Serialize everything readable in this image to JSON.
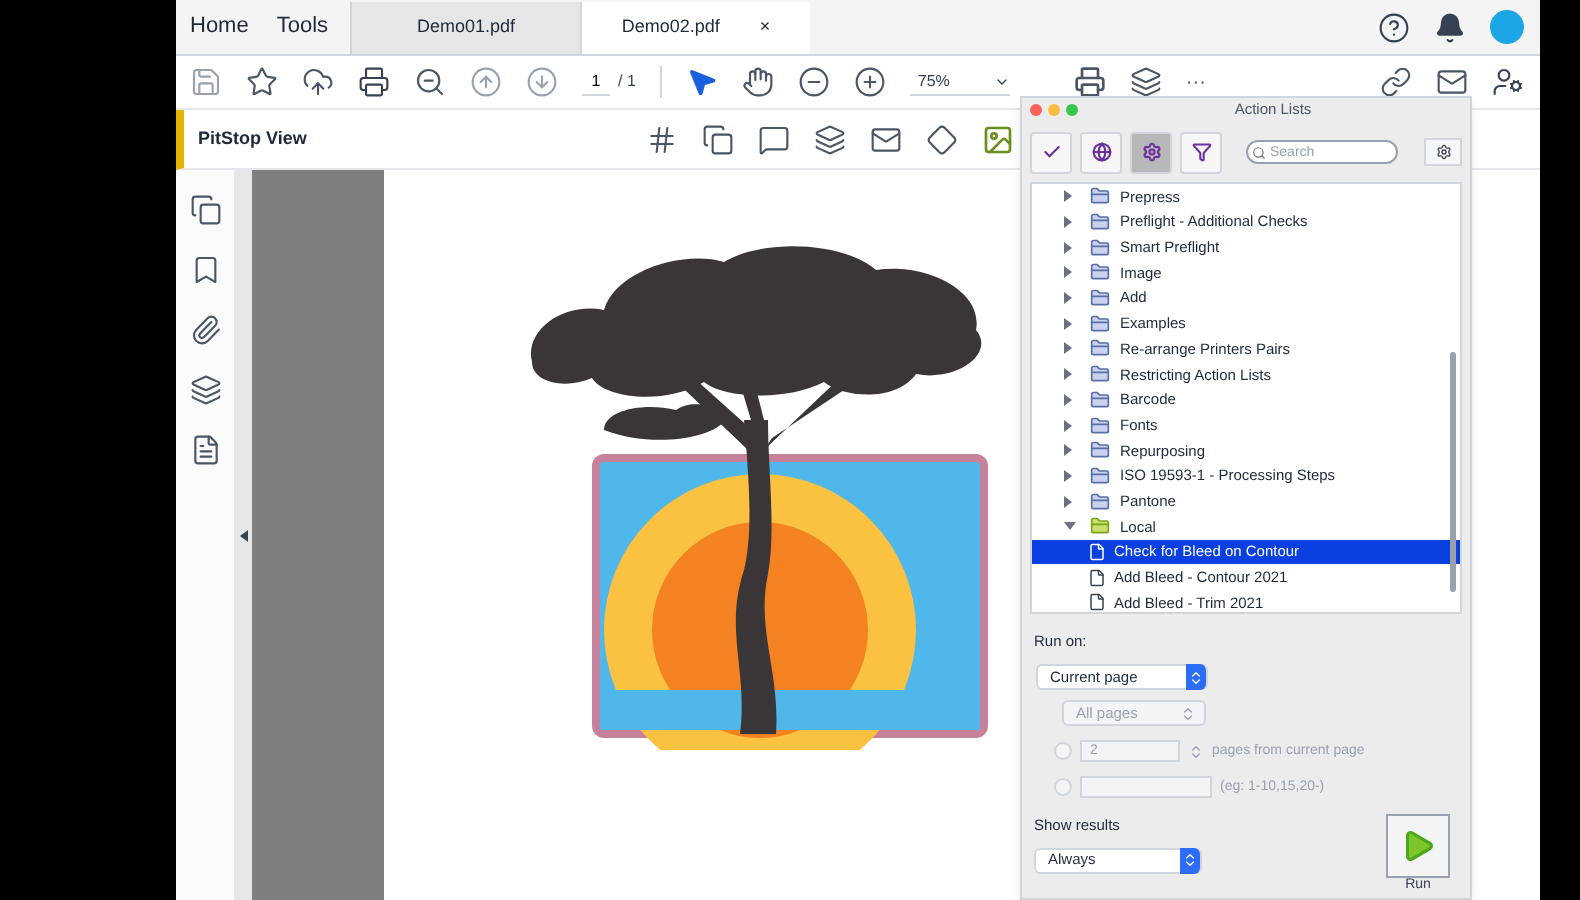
{
  "top_bar": {
    "nav": [
      "Home",
      "Tools"
    ],
    "tabs": [
      {
        "label": "Demo01.pdf",
        "selected": false
      },
      {
        "label": "Demo02.pdf",
        "selected": true
      }
    ],
    "close_glyph": "×"
  },
  "toolbar": {
    "page": "1",
    "page_total": "/ 1",
    "zoom": "75%",
    "ellipsis": "···"
  },
  "pitstop_bar": {
    "title": "PitStop View"
  },
  "action_lists": {
    "title": "Action Lists",
    "filters": [
      {
        "kind": "check",
        "selected": false
      },
      {
        "kind": "globe",
        "selected": false
      },
      {
        "kind": "gear",
        "selected": true
      },
      {
        "kind": "funnel",
        "selected": false
      }
    ],
    "search": {
      "placeholder": "Search"
    },
    "tree": [
      {
        "label": "Prepress",
        "expanded": false
      },
      {
        "label": "Preflight - Additional Checks",
        "expanded": false
      },
      {
        "label": "Smart Preflight",
        "expanded": false
      },
      {
        "label": "Image",
        "expanded": false
      },
      {
        "label": "Add",
        "expanded": false
      },
      {
        "label": "Examples",
        "expanded": false
      },
      {
        "label": "Re-arrange Printers Pairs",
        "expanded": false
      },
      {
        "label": "Restricting Action Lists",
        "expanded": false
      },
      {
        "label": "Barcode",
        "expanded": false
      },
      {
        "label": "Fonts",
        "expanded": false
      },
      {
        "label": "Repurposing",
        "expanded": false
      },
      {
        "label": "ISO 19593-1 - Processing Steps",
        "expanded": false
      },
      {
        "label": "Pantone",
        "expanded": false
      },
      {
        "label": "Local",
        "expanded": true,
        "children": [
          {
            "label": "Check for Bleed on Contour",
            "selected": true
          },
          {
            "label": "Add Bleed - Contour 2021",
            "selected": false
          },
          {
            "label": "Add Bleed - Trim 2021",
            "selected": false
          }
        ]
      }
    ],
    "run_on": {
      "label": "Run on:",
      "target": "Current page",
      "pages": {
        "value": "All pages",
        "disabled": true
      },
      "ranges": [
        {
          "value": "2",
          "suffix": "pages from current page",
          "checked": false
        },
        {
          "placeholder": "(eg: 1-10,15,20-)",
          "checked": false
        }
      ]
    },
    "show_results": {
      "label": "Show results",
      "value": "Always"
    },
    "run_button": {
      "label": "Run"
    }
  }
}
